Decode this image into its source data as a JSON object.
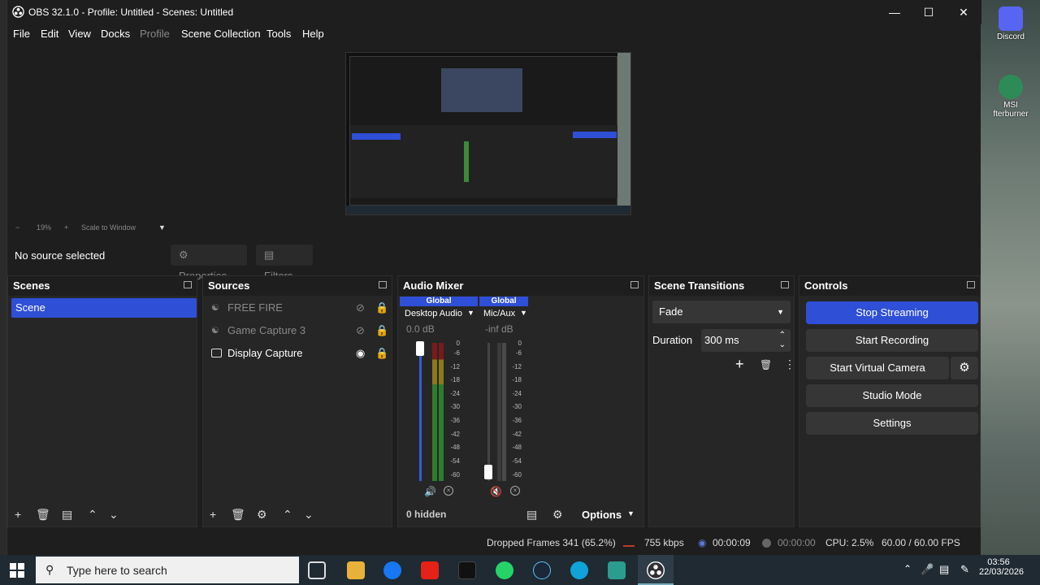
{
  "window": {
    "title": "OBS 32.1.0 - Profile: Untitled - Scenes: Untitled"
  },
  "menu": [
    "File",
    "Edit",
    "View",
    "Docks",
    "Profile",
    "Scene Collection",
    "Tools",
    "Help"
  ],
  "zoom": {
    "percent": "19%",
    "mode": "Scale to Window"
  },
  "source_bar": {
    "status": "No source selected",
    "properties": "Properties",
    "filters": "Filters"
  },
  "scenes": {
    "title": "Scenes",
    "items": [
      "Scene"
    ]
  },
  "sources": {
    "title": "Sources",
    "items": [
      {
        "name": "FREE FIRE",
        "visible": false
      },
      {
        "name": "Game Capture 3",
        "visible": false
      },
      {
        "name": "Display Capture",
        "visible": true
      }
    ]
  },
  "mixer": {
    "title": "Audio Mixer",
    "channels": [
      {
        "tag": "Global",
        "name": "Desktop Audio",
        "level": "0.0 dB"
      },
      {
        "tag": "Global",
        "name": "Mic/Aux",
        "level": "-inf dB"
      }
    ],
    "scale": [
      "0",
      "-6",
      "-12",
      "-18",
      "-24",
      "-30",
      "-36",
      "-42",
      "-48",
      "-54",
      "-60"
    ],
    "hidden": "0 hidden",
    "options": "Options"
  },
  "transitions": {
    "title": "Scene Transitions",
    "selected": "Fade",
    "duration_label": "Duration",
    "duration_value": "300 ms"
  },
  "controls": {
    "title": "Controls",
    "stop_streaming": "Stop Streaming",
    "start_recording": "Start Recording",
    "start_virtual_camera": "Start Virtual Camera",
    "studio_mode": "Studio Mode",
    "settings": "Settings"
  },
  "status": {
    "dropped": "Dropped Frames 341 (65.2%)",
    "kbps": "755 kbps",
    "stream_time": "00:00:09",
    "rec_time": "00:00:00",
    "cpu": "CPU: 2.5%",
    "fps": "60.00 / 60.00 FPS"
  },
  "taskbar": {
    "search_placeholder": "Type here to search",
    "time": "03:56",
    "date": "22/03/2026"
  },
  "desktop": {
    "icons": [
      "Discord",
      "MSI",
      "fterburner"
    ]
  },
  "colors": {
    "accent": "#2f4fd6",
    "window_bg": "#1e1e1e",
    "dock_bg": "#262626"
  }
}
